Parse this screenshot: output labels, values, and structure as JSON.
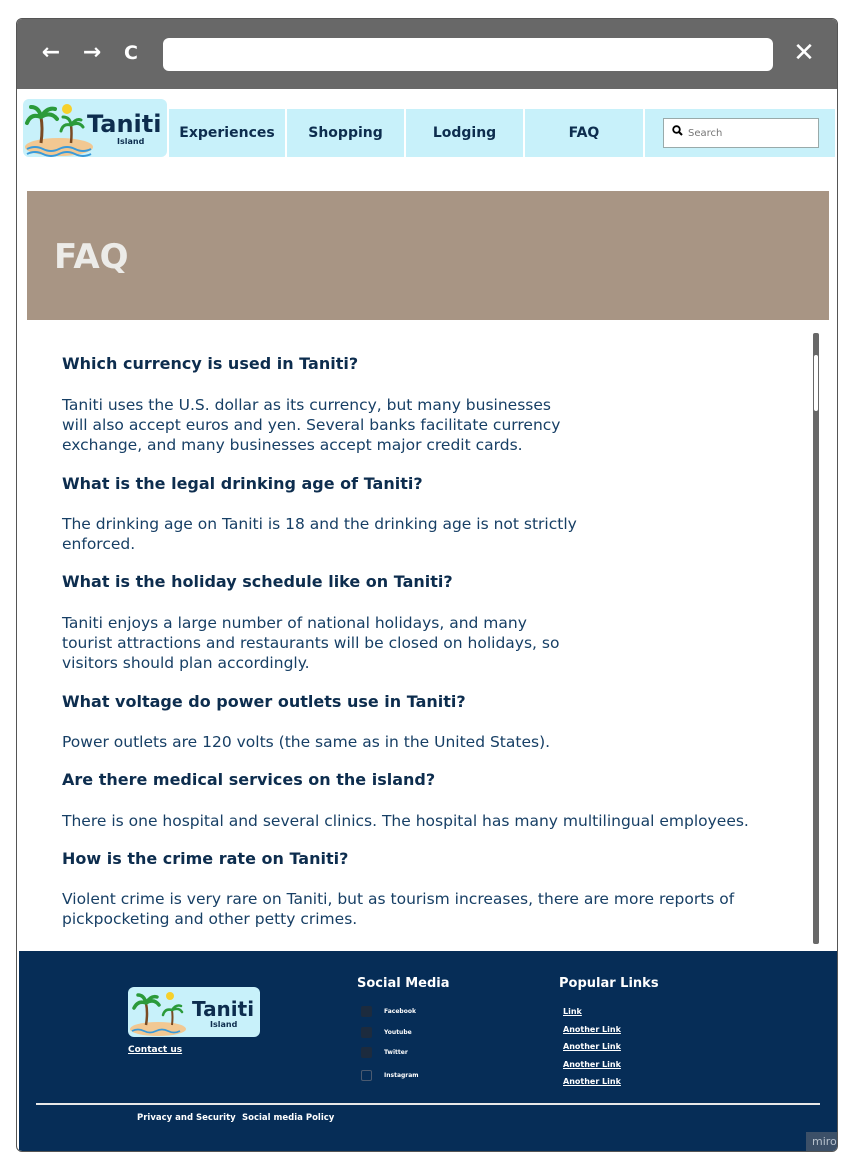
{
  "browser": {
    "back_icon": "←",
    "forward_icon": "→",
    "reload_icon": "C",
    "close_icon": "✕",
    "url": ""
  },
  "header": {
    "logo": {
      "name": "Taniti",
      "sub": "Island"
    },
    "nav": [
      "Experiences",
      "Shopping",
      "Lodging",
      "FAQ"
    ],
    "search_placeholder": "Search"
  },
  "banner": {
    "title": "FAQ"
  },
  "faq": [
    {
      "q": "Which currency is used in Taniti?",
      "a": [
        "Taniti uses the U.S. dollar as its currency, but many businesses",
        "will also accept euros and yen. Several banks facilitate currency",
        "exchange, and many businesses accept major credit cards."
      ]
    },
    {
      "q": "What is the legal drinking age of Taniti?",
      "a": [
        "The drinking age on Taniti is 18 and the drinking age is not strictly",
        "enforced."
      ]
    },
    {
      "q": "What is the holiday schedule like on Taniti?",
      "a": [
        "Taniti enjoys a large number of national holidays, and many",
        "tourist attractions and restaurants will be closed on holidays, so",
        "visitors should plan accordingly."
      ]
    },
    {
      "q": "What voltage do power outlets use in Taniti?",
      "a": [
        "Power outlets are 120 volts (the same as in the United States)."
      ]
    },
    {
      "q": "Are there medical services on the island?",
      "a": [
        "There is one hospital and several clinics. The hospital has many multilingual employees."
      ]
    },
    {
      "q": "How is the crime rate on Taniti?",
      "a": [
        "Violent crime is very rare on Taniti, but as tourism increases, there are more reports of",
        "pickpocketing and other petty crimes."
      ]
    }
  ],
  "footer": {
    "logo": {
      "name": "Taniti",
      "sub": "Island"
    },
    "contact": "Contact us",
    "social_heading": "Social Media",
    "social": [
      "Facebook",
      "Youtube",
      "Twitter",
      "Instagram"
    ],
    "popular_heading": "Popular Links",
    "links": [
      "Link",
      "Another Link",
      "Another Link",
      "Another Link",
      "Another Link"
    ],
    "legal": [
      "Privacy and Security",
      "Social media Policy"
    ],
    "watermark": "miro"
  },
  "colors": {
    "navy": "#062d57",
    "light_cyan": "#c8f1fa",
    "banner": "#a89584",
    "chrome": "#686868"
  }
}
